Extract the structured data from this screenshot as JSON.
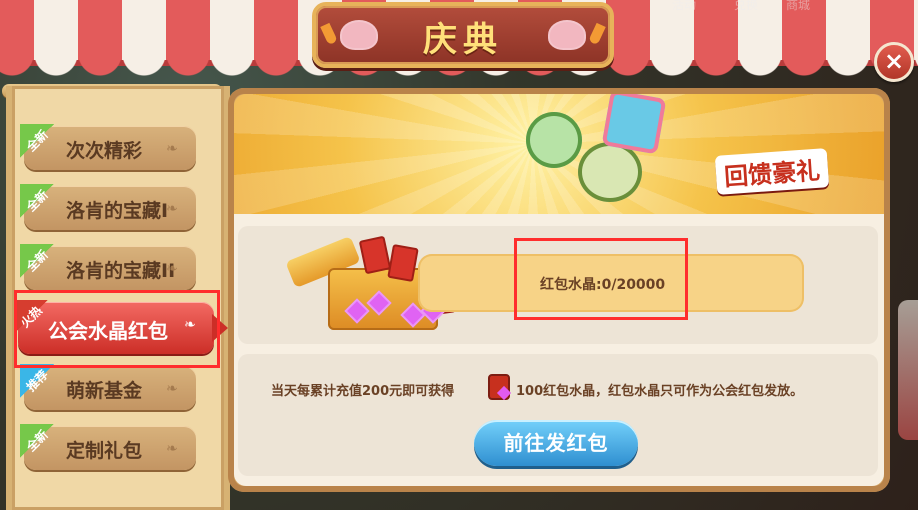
{
  "top_nav": {
    "hint_left": "活动",
    "hint_mid": "兑换",
    "hint_right": "商城"
  },
  "header": {
    "title": "庆典",
    "close_symbol": "×"
  },
  "sidebar": {
    "items": [
      {
        "label": "次次精彩",
        "badge": "全新",
        "badge_color": "#76c84a",
        "active": false
      },
      {
        "label": "洛肯的宝藏I",
        "badge": "全新",
        "badge_color": "#76c84a",
        "active": false
      },
      {
        "label": "洛肯的宝藏II",
        "badge": "全新",
        "badge_color": "#76c84a",
        "active": false
      },
      {
        "label": "公会水晶红包",
        "badge": "火热",
        "badge_color": "#d63d2f",
        "active": true
      },
      {
        "label": "萌新基金",
        "badge": "推荐",
        "badge_color": "#3ab6e7",
        "active": false
      },
      {
        "label": "定制礼包",
        "badge": "全新",
        "badge_color": "#76c84a",
        "active": false
      }
    ]
  },
  "banner": {
    "title": "回馈豪礼"
  },
  "progress": {
    "text": "红包水晶:0/20000"
  },
  "description": {
    "part1": "当天每累计充值200元即可获得",
    "part2": "100红包水晶，红包水晶只可作为公会红包发放。"
  },
  "cta": {
    "label": "前往发红包"
  },
  "colors": {
    "accent_red": "#cc2e27",
    "button_blue": "#2f8fd0",
    "annotation_red": "#ff2d2d"
  }
}
